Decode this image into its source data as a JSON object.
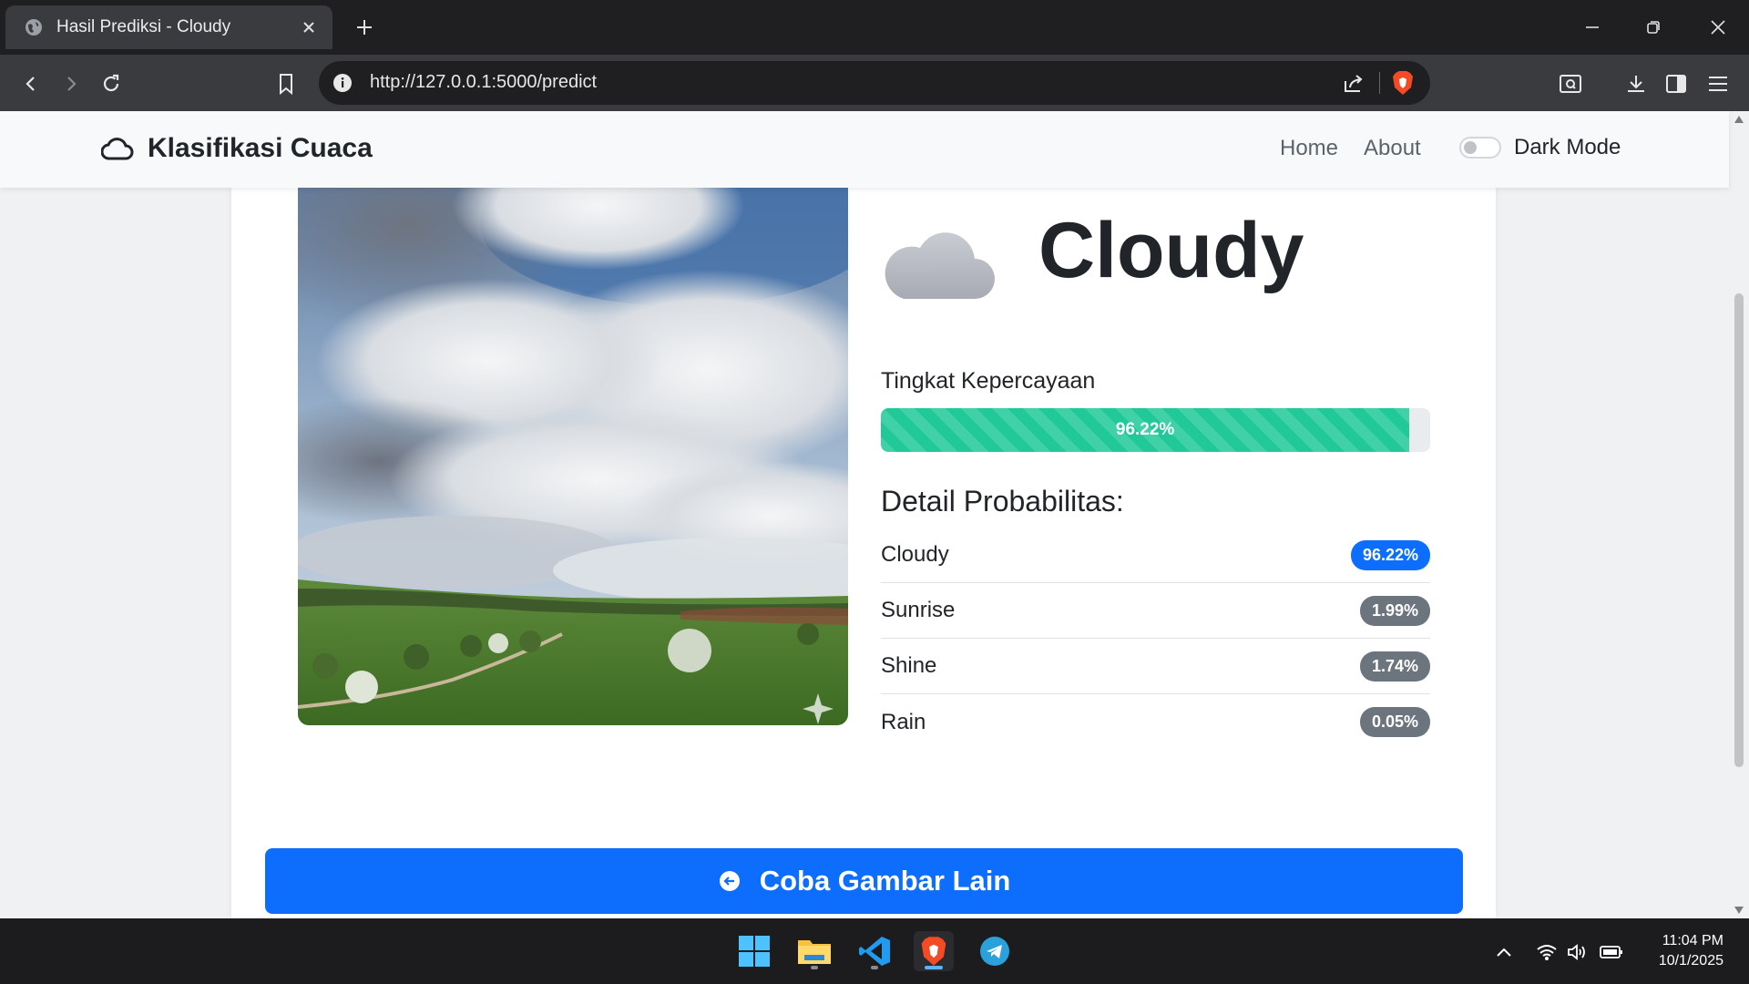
{
  "browser": {
    "tab_title": "Hasil Prediksi - Cloudy",
    "url": "http://127.0.0.1:5000/predict"
  },
  "navbar": {
    "brand": "Klasifikasi Cuaca",
    "links": [
      "Home",
      "About"
    ],
    "dark_mode_label": "Dark Mode",
    "dark_mode_on": false
  },
  "result": {
    "label": "Cloudy",
    "confidence_label": "Tingkat Kepercayaan",
    "confidence_text": "96.22%",
    "confidence_value": 96.22,
    "detail_title": "Detail Probabilitas:",
    "probabilities": [
      {
        "name": "Cloudy",
        "value": "96.22%"
      },
      {
        "name": "Sunrise",
        "value": "1.99%"
      },
      {
        "name": "Shine",
        "value": "1.74%"
      },
      {
        "name": "Rain",
        "value": "0.05%"
      }
    ]
  },
  "cta": {
    "label": "Coba Gambar Lain"
  },
  "taskbar": {
    "time": "11:04 PM",
    "date": "10/1/2025"
  },
  "colors": {
    "primary": "#0d6efd",
    "success_bar": "#20c997",
    "badge_secondary": "#6c757d"
  }
}
